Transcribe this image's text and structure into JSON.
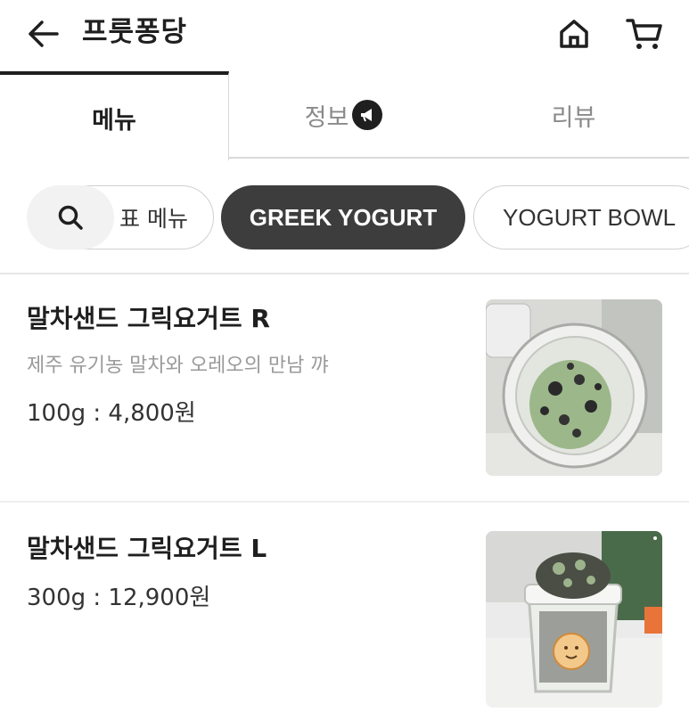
{
  "header": {
    "title": "프룻퐁당",
    "back_icon": "arrow-left-icon",
    "home_icon": "home-icon",
    "cart_icon": "cart-icon"
  },
  "tabs": [
    {
      "label": "메뉴",
      "active": true
    },
    {
      "label": "정보",
      "active": false,
      "badge_icon": "megaphone-icon"
    },
    {
      "label": "리뷰",
      "active": false
    }
  ],
  "categories": {
    "search_icon": "search-icon",
    "items": [
      {
        "label": "표 메뉴",
        "selected": false
      },
      {
        "label": "GREEK YOGURT",
        "selected": true
      },
      {
        "label": "YOGURT BOWL",
        "selected": false
      }
    ]
  },
  "menu_items": [
    {
      "name": "말차샌드 그릭요거트 R",
      "description": "제주 유기농 말차와 오레오의 만남 꺄",
      "price": "100g : 4,800원",
      "image_icon": "matcha-yogurt-cup-photo"
    },
    {
      "name": "말차샌드 그릭요거트 L",
      "price": "300g : 12,900원",
      "image_icon": "oreo-yogurt-tall-cup-photo"
    }
  ],
  "colors": {
    "active_chip": "#3d3d3d",
    "text_primary": "#1f1f1f",
    "text_muted": "#9a9a9a"
  }
}
